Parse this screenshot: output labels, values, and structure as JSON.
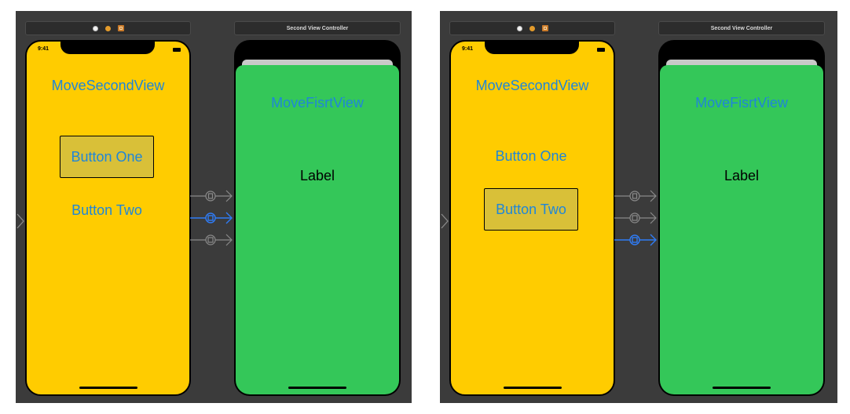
{
  "scenes": [
    {
      "id": "left",
      "selected_button": "one",
      "first_vc": {
        "time": "9:41",
        "title_button": "MoveSecondView",
        "button_one": "Button One",
        "button_two": "Button Two",
        "scene_dock_icons": [
          "view-controller-icon",
          "first-responder-icon",
          "exit-icon"
        ]
      },
      "second_vc": {
        "bar_title": "Second View Controller",
        "title_button": "MoveFisrtView",
        "label": "Label"
      },
      "segues": [
        {
          "type": "show",
          "highlighted": false
        },
        {
          "type": "present-modally",
          "highlighted": true
        },
        {
          "type": "present-modally",
          "highlighted": false
        }
      ]
    },
    {
      "id": "right",
      "selected_button": "two",
      "first_vc": {
        "time": "9:41",
        "title_button": "MoveSecondView",
        "button_one": "Button One",
        "button_two": "Button Two",
        "scene_dock_icons": [
          "view-controller-icon",
          "first-responder-icon",
          "exit-icon"
        ]
      },
      "second_vc": {
        "bar_title": "Second View Controller",
        "title_button": "MoveFisrtView",
        "label": "Label"
      },
      "segues": [
        {
          "type": "show",
          "highlighted": false
        },
        {
          "type": "present-modally",
          "highlighted": false
        },
        {
          "type": "present-modally",
          "highlighted": true
        }
      ]
    }
  ],
  "colors": {
    "canvas": "#3b3b3b",
    "first_view_background": "#ffcc00",
    "second_view_background": "#34c759",
    "button_text": "#1f86d8",
    "selected_button_fill": "#d9c038",
    "segue_normal": "#8a8a8a",
    "segue_highlighted": "#2f7cf6"
  }
}
